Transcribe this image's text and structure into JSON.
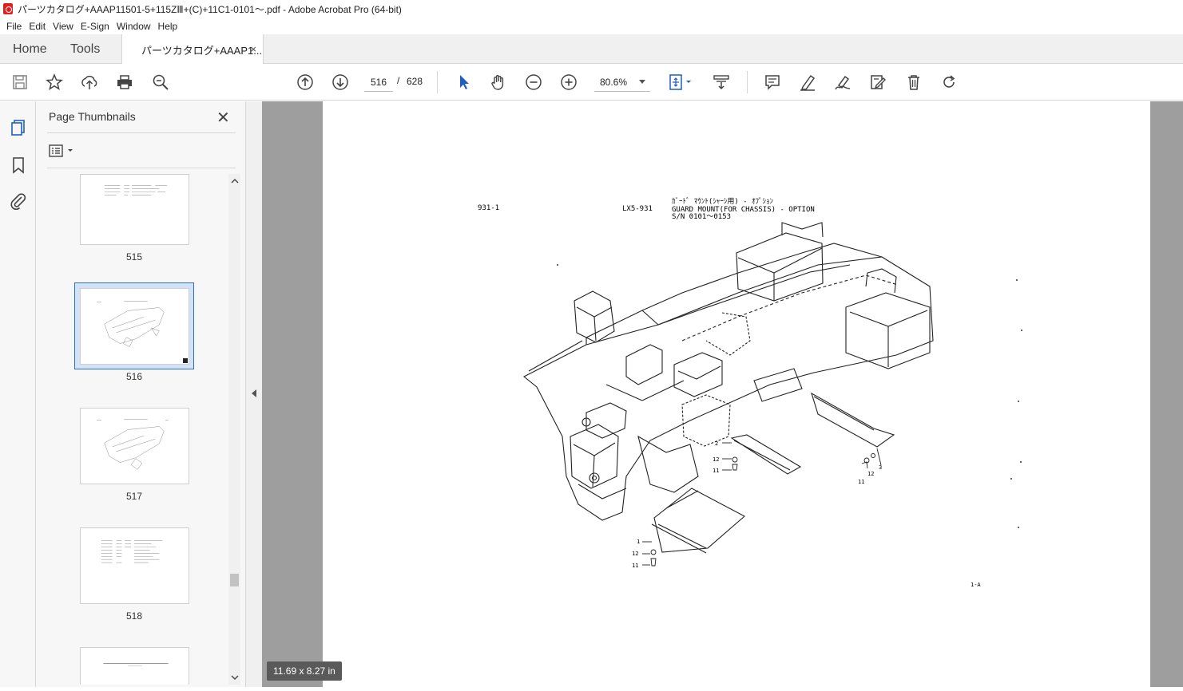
{
  "window": {
    "title": "パーツカタログ+AAAP11501-5+115ZⅢ+(C)+11C1-0101〜.pdf - Adobe Acrobat Pro (64-bit)"
  },
  "menu": [
    "File",
    "Edit",
    "View",
    "E-Sign",
    "Window",
    "Help"
  ],
  "tabs": {
    "home": "Home",
    "tools": "Tools",
    "document": "パーツカタログ+AAAP1...",
    "close": "×"
  },
  "toolbar": {
    "icons": [
      "save-icon",
      "bookmark-star-icon",
      "upload-icon",
      "print-icon",
      "zoom-search-icon",
      "page-up-icon",
      "page-down-icon",
      "select-cursor-icon",
      "hand-icon",
      "zoom-out-icon",
      "zoom-in-icon",
      "fit-page-icon",
      "scroll-mode-icon",
      "comment-icon",
      "highlight-icon",
      "sign-icon",
      "edit-icon",
      "delete-icon",
      "rotate-icon"
    ],
    "current_page": "516",
    "page_sep": "/",
    "total_pages": "628",
    "zoom": "80.6%"
  },
  "sidebar": {
    "title": "Page Thumbnails",
    "close": "✕",
    "thumbnails": [
      {
        "label": "515"
      },
      {
        "label": "516",
        "selected": true
      },
      {
        "label": "517"
      },
      {
        "label": "518"
      }
    ]
  },
  "document": {
    "size_badge": "11.69 x 8.27 in",
    "header_left": "931-1",
    "header_model": "LX5-931",
    "header_jp": "ｶﾞｰﾄﾞ ﾏｳﾝﾄ(ｼｬｰｼ用) - ｵﾌﾟｼｮﾝ",
    "header_en": "GUARD MOUNT(FOR CHASSIS) - OPTION",
    "header_sn": "S/N 0101～0153",
    "footer_ref": "1-A",
    "callouts": [
      "1",
      "12",
      "11",
      "2",
      "12",
      "11",
      "3",
      "12",
      "11"
    ]
  }
}
